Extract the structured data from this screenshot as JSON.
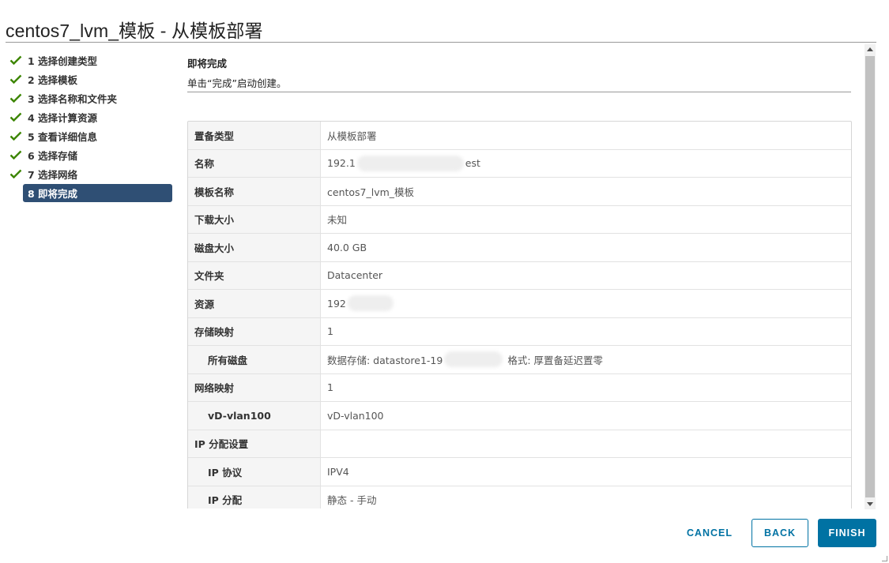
{
  "title": "centos7_lvm_模板 - 从模板部署",
  "steps": [
    {
      "label": "1 选择创建类型",
      "done": true
    },
    {
      "label": "2 选择模板",
      "done": true
    },
    {
      "label": "3 选择名称和文件夹",
      "done": true
    },
    {
      "label": "4 选择计算资源",
      "done": true
    },
    {
      "label": "5 查看详细信息",
      "done": true
    },
    {
      "label": "6 选择存储",
      "done": true
    },
    {
      "label": "7 选择网络",
      "done": true
    },
    {
      "label": "8 即将完成",
      "done": false,
      "current": true
    }
  ],
  "section": {
    "title": "即将完成",
    "subtitle": "单击“完成”启动创建。"
  },
  "rows": [
    {
      "key": "置备类型",
      "value": "从模板部署"
    },
    {
      "key": "名称",
      "value": "192.1",
      "value_suffix": "est"
    },
    {
      "key": "模板名称",
      "value": "centos7_lvm_模板"
    },
    {
      "key": "下载大小",
      "value": "未知"
    },
    {
      "key": "磁盘大小",
      "value": "40.0 GB"
    },
    {
      "key": "文件夹",
      "value": "Datacenter"
    },
    {
      "key": "资源",
      "value": "192"
    },
    {
      "key": "存储映射",
      "value": "1"
    },
    {
      "key": "所有磁盘",
      "value": "数据存储: datastore1-19",
      "value_suffix": "格式: 厚置备延迟置零",
      "indent": true
    },
    {
      "key": "网络映射",
      "value": "1"
    },
    {
      "key": "vD-vlan100",
      "value": "vD-vlan100",
      "indent": true
    },
    {
      "key": "IP 分配设置",
      "value": ""
    },
    {
      "key": "IP 协议",
      "value": "IPV4",
      "indent": true
    },
    {
      "key": "IP 分配",
      "value": "静态 - 手动",
      "indent": true
    }
  ],
  "buttons": {
    "cancel": "CANCEL",
    "back": "BACK",
    "finish": "FINISH"
  },
  "colors": {
    "accent": "#0072a3",
    "current_step": "#2f4f74",
    "check": "#3c8500"
  }
}
